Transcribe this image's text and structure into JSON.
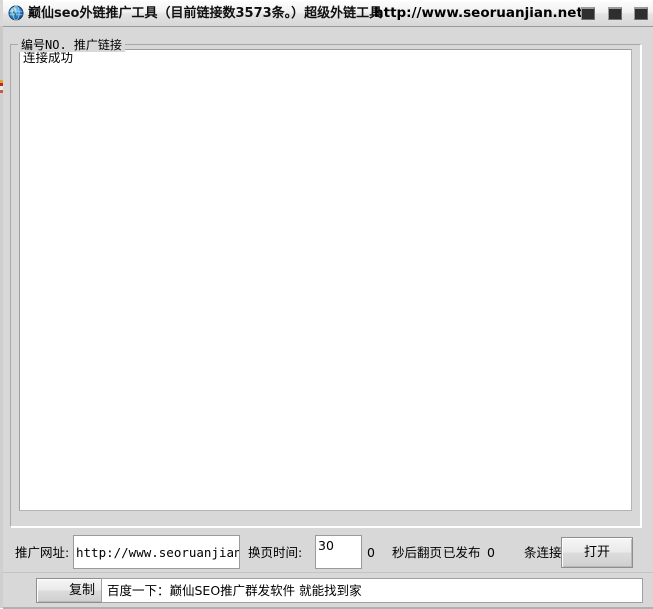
{
  "window": {
    "icon": "globe-icon",
    "title": "巅仙seo外链推广工具（目前链接数3573条。）超级外链工具",
    "url": "http://www.seoruanjian.net/",
    "controls": {
      "minimize": "minimize-icon",
      "maximize": "maximize-icon",
      "close": "close-icon"
    }
  },
  "list_panel": {
    "legend": "编号NO. 推广链接",
    "rows": [
      {
        "text": "连接成功"
      }
    ]
  },
  "controls": {
    "url_label": "推广网址:",
    "url_value": "http://www.seoruanjian.net/",
    "page_time_label": "换页时间:",
    "page_time_value": "30",
    "page_time_extra": "0",
    "seconds_label": "秒后翻页",
    "published_label": "已发布",
    "published_count": "0",
    "connections_label": "条连接",
    "open_button": "打开"
  },
  "footer": {
    "copy_button": "复制",
    "promo_text": "百度一下：巅仙SEO推广群发软件 就能找到家"
  },
  "colors": {
    "window_background": "#d8d8d8",
    "titlebar_gradient_top": "#fdfdfd",
    "titlebar_gradient_bottom": "#d7d7d7",
    "list_background": "#ffffff",
    "button_face": "#eaeaea",
    "text": "#000000",
    "window_button": "#2e2e2e"
  }
}
